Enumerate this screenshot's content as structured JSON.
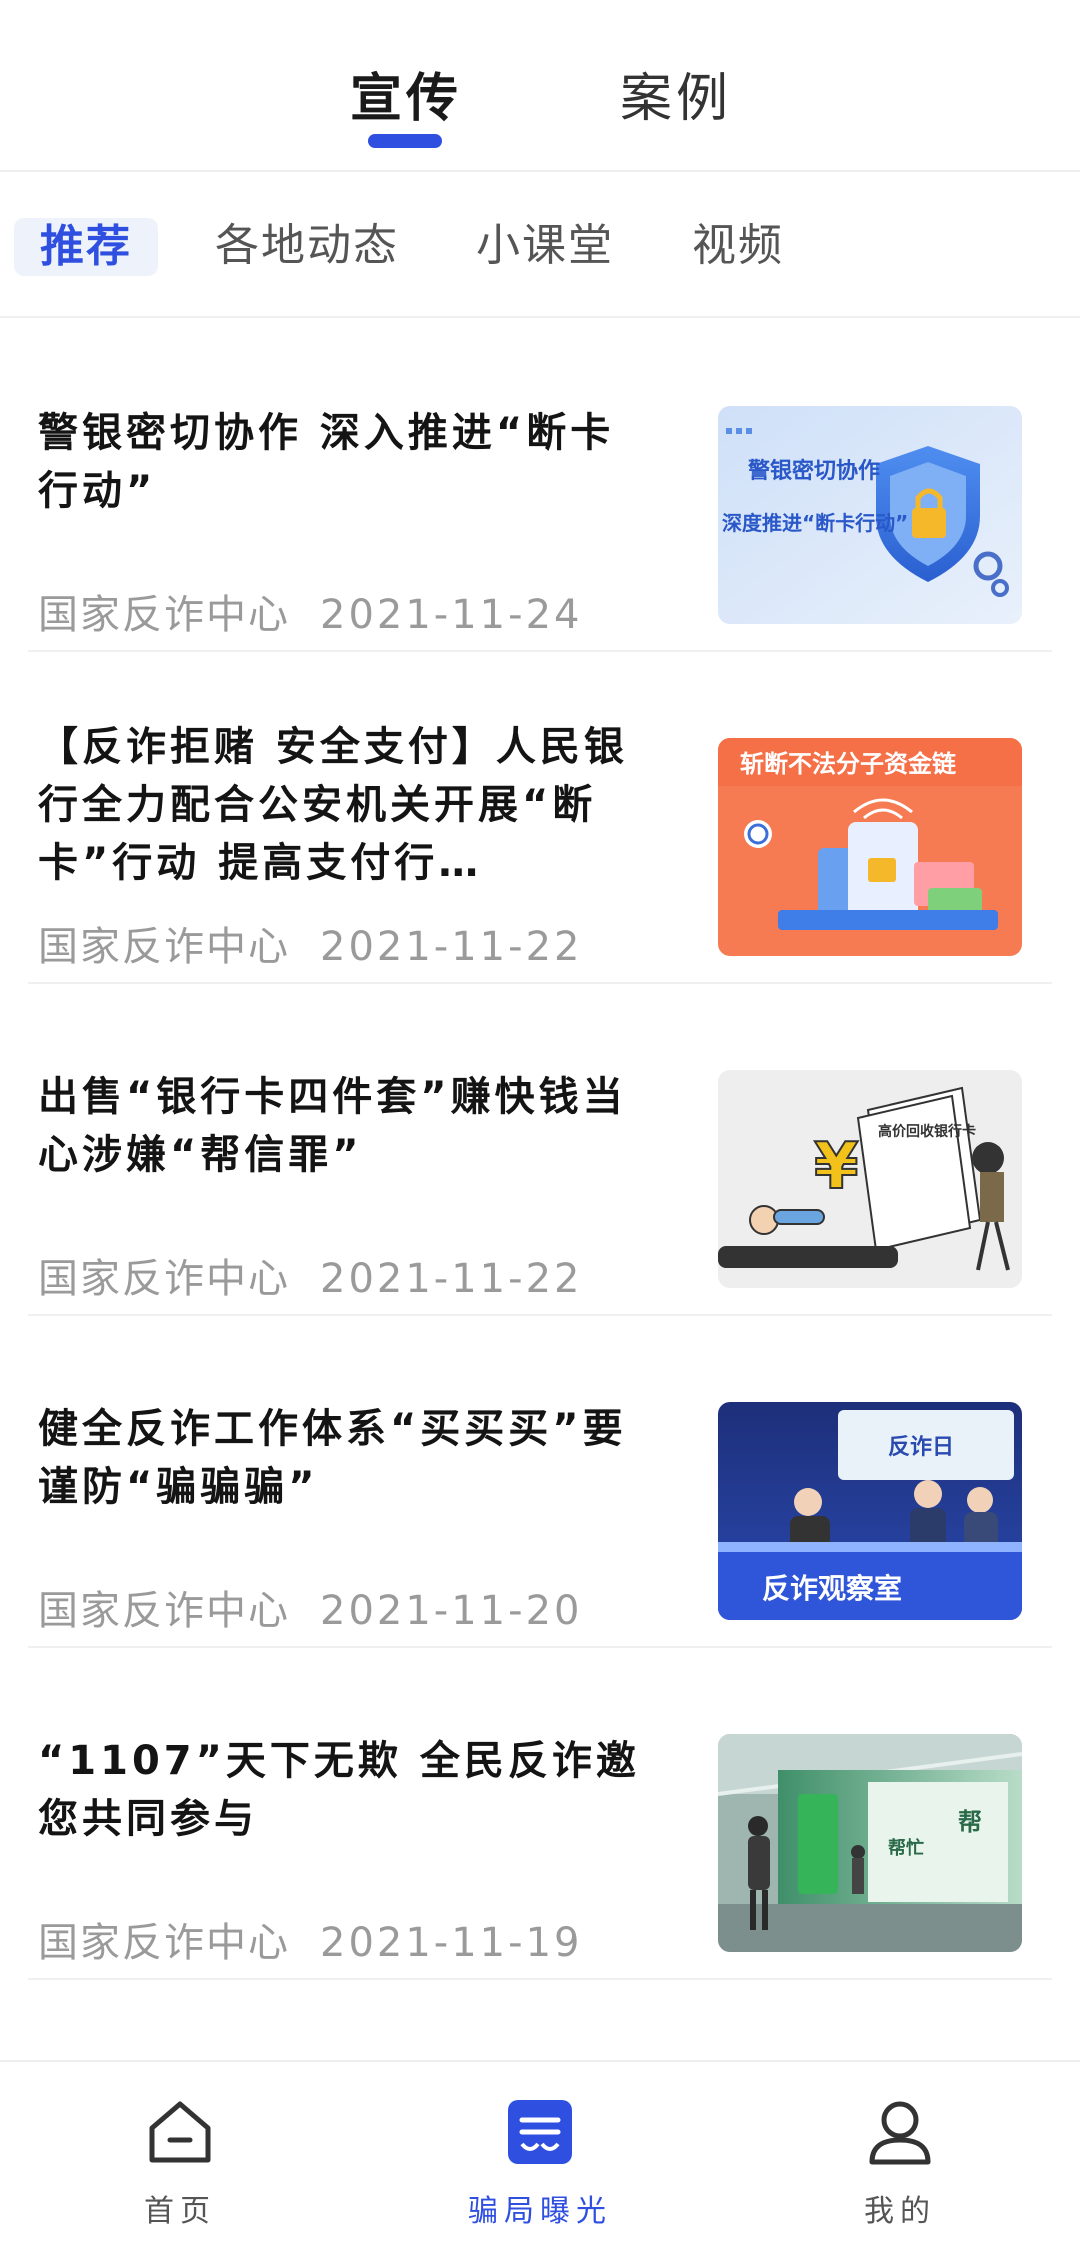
{
  "header": {
    "tabs": [
      {
        "label": "宣传",
        "active": true
      },
      {
        "label": "案例",
        "active": false
      }
    ]
  },
  "categories": {
    "items": [
      {
        "label": "推荐",
        "active": true
      },
      {
        "label": "各地动态",
        "active": false
      },
      {
        "label": "小课堂",
        "active": false
      },
      {
        "label": "视频",
        "active": false
      }
    ]
  },
  "news": [
    {
      "title": "警银密切协作 深入推进“断卡行动”",
      "source": "国家反诈中心",
      "date": "2021-11-24",
      "thumb_text_1": "警银密切协作",
      "thumb_text_2": "深度推进“断卡行动”"
    },
    {
      "title": "【反诈拒赌 安全支付】人民银行全力配合公安机关开展“断卡”行动 提高支付行…",
      "source": "国家反诈中心",
      "date": "2021-11-22",
      "thumb_text_1": "斩断不法分子资金链"
    },
    {
      "title": "出售“银行卡四件套”赚快钱当心涉嫌“帮信罪”",
      "source": "国家反诈中心",
      "date": "2021-11-22",
      "thumb_text_1": "高价回收银行卡"
    },
    {
      "title": "健全反诈工作体系“买买买”要谨防“骗骗骗”",
      "source": "国家反诈中心",
      "date": "2021-11-20",
      "thumb_text_1": "反诈观察室",
      "thumb_text_2": "反诈日"
    },
    {
      "title": "“1107”天下无欺 全民反诈邀您共同参与",
      "source": "国家反诈中心",
      "date": "2021-11-19",
      "thumb_text_1": "帮",
      "thumb_text_2": "帮忙"
    }
  ],
  "bottom_nav": {
    "items": [
      {
        "label": "首页",
        "icon": "home-icon",
        "active": false
      },
      {
        "label": "骗局曝光",
        "icon": "expose-icon",
        "active": true
      },
      {
        "label": "我的",
        "icon": "user-icon",
        "active": false
      }
    ]
  },
  "colors": {
    "accent": "#2f4fe0",
    "meta_text": "#9a9a9a",
    "category_active_bg": "#eef3fb"
  }
}
